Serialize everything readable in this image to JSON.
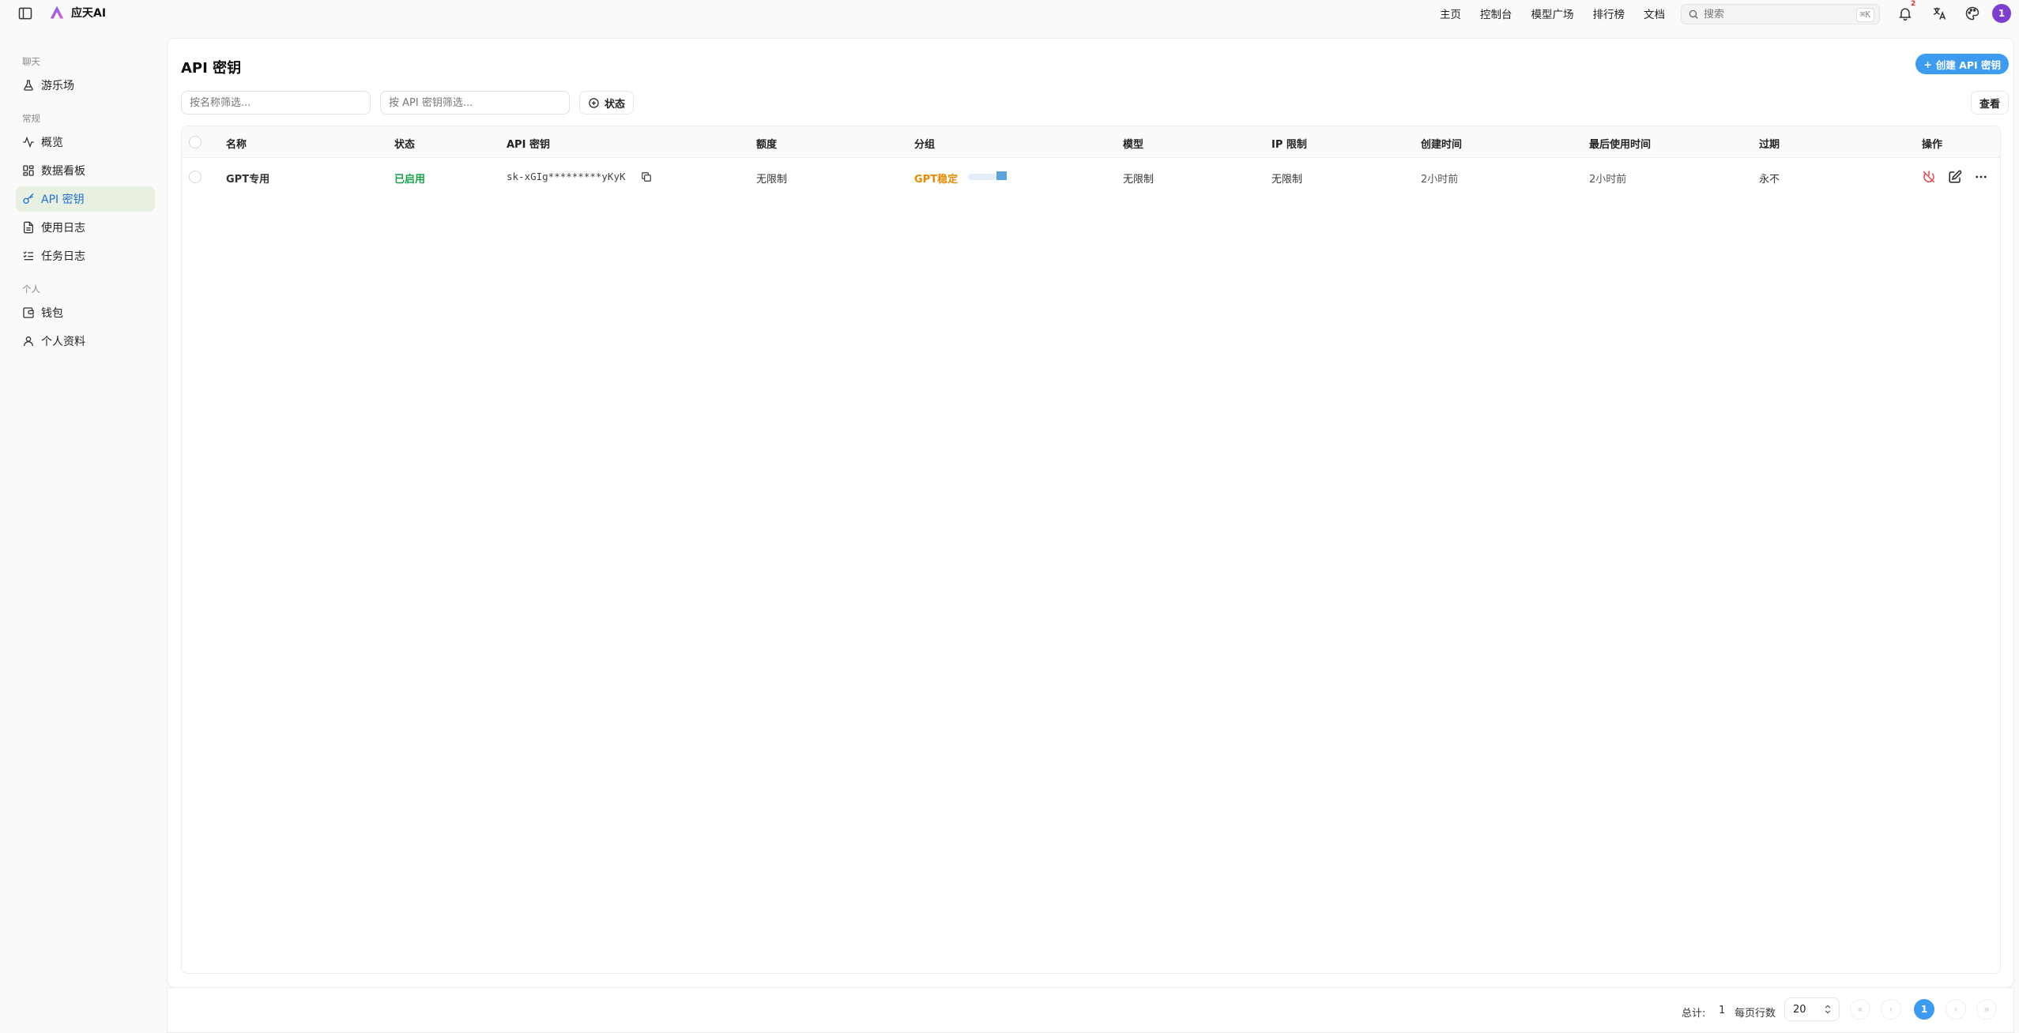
{
  "brand": {
    "name": "应天AI"
  },
  "topnav": [
    "主页",
    "控制台",
    "模型广场",
    "排行榜",
    "文档"
  ],
  "search": {
    "placeholder": "搜索",
    "shortcut": "⌘K"
  },
  "notifications": {
    "count": "2"
  },
  "user": {
    "avatar_letter": "1",
    "avatar_color": "#7e3fd1"
  },
  "sidebar": {
    "groups": [
      {
        "label": "聊天",
        "items": [
          {
            "label": "游乐场",
            "icon": "flask-icon"
          }
        ]
      },
      {
        "label": "常规",
        "items": [
          {
            "label": "概览",
            "icon": "activity-icon"
          },
          {
            "label": "数据看板",
            "icon": "dashboard-icon"
          },
          {
            "label": "API 密钥",
            "icon": "key-icon",
            "active": true
          },
          {
            "label": "使用日志",
            "icon": "file-text-icon"
          },
          {
            "label": "任务日志",
            "icon": "list-checks-icon"
          }
        ]
      },
      {
        "label": "个人",
        "items": [
          {
            "label": "钱包",
            "icon": "wallet-icon"
          },
          {
            "label": "个人资料",
            "icon": "user-icon"
          }
        ]
      }
    ]
  },
  "page": {
    "title": "API 密钥",
    "create_label": "创建 API 密钥",
    "filter_name_placeholder": "按名称筛选...",
    "filter_key_placeholder": "按 API 密钥筛选...",
    "status_filter_label": "状态",
    "view_label": "查看"
  },
  "table": {
    "headers": [
      "名称",
      "状态",
      "API 密钥",
      "额度",
      "分组",
      "模型",
      "IP 限制",
      "创建时间",
      "最后使用时间",
      "过期",
      "操作"
    ],
    "rows": [
      {
        "name": "GPT专用",
        "status": "已启用",
        "key": "sk-xGIg*********yKyK",
        "quota": "无限制",
        "group": "GPT稳定",
        "models": "无限制",
        "ip_limit": "无限制",
        "created": "2小时前",
        "last_used": "2小时前",
        "expires": "永不"
      }
    ]
  },
  "footer": {
    "total_label": "总计:",
    "total_value": "1",
    "per_page_label": "每页行数",
    "per_page_value": "20",
    "current_page": "1"
  },
  "colors": {
    "accent": "#3d9bf0",
    "status_enabled": "#16a34a",
    "group_tag": "#e98a00",
    "sidebar_active_bg": "#e8f1e1"
  }
}
